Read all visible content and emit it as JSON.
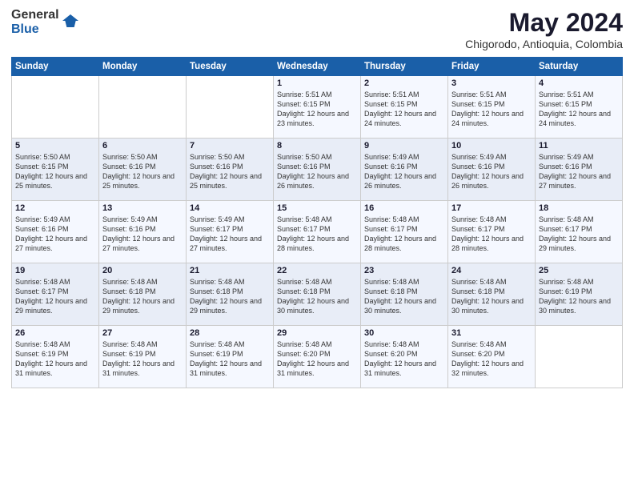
{
  "header": {
    "logo_general": "General",
    "logo_blue": "Blue",
    "title": "May 2024",
    "subtitle": "Chigorodo, Antioquia, Colombia"
  },
  "calendar": {
    "days_of_week": [
      "Sunday",
      "Monday",
      "Tuesday",
      "Wednesday",
      "Thursday",
      "Friday",
      "Saturday"
    ],
    "weeks": [
      [
        {
          "day": "",
          "sunrise": "",
          "sunset": "",
          "daylight": ""
        },
        {
          "day": "",
          "sunrise": "",
          "sunset": "",
          "daylight": ""
        },
        {
          "day": "",
          "sunrise": "",
          "sunset": "",
          "daylight": ""
        },
        {
          "day": "1",
          "sunrise": "Sunrise: 5:51 AM",
          "sunset": "Sunset: 6:15 PM",
          "daylight": "Daylight: 12 hours and 23 minutes."
        },
        {
          "day": "2",
          "sunrise": "Sunrise: 5:51 AM",
          "sunset": "Sunset: 6:15 PM",
          "daylight": "Daylight: 12 hours and 24 minutes."
        },
        {
          "day": "3",
          "sunrise": "Sunrise: 5:51 AM",
          "sunset": "Sunset: 6:15 PM",
          "daylight": "Daylight: 12 hours and 24 minutes."
        },
        {
          "day": "4",
          "sunrise": "Sunrise: 5:51 AM",
          "sunset": "Sunset: 6:15 PM",
          "daylight": "Daylight: 12 hours and 24 minutes."
        }
      ],
      [
        {
          "day": "5",
          "sunrise": "Sunrise: 5:50 AM",
          "sunset": "Sunset: 6:15 PM",
          "daylight": "Daylight: 12 hours and 25 minutes."
        },
        {
          "day": "6",
          "sunrise": "Sunrise: 5:50 AM",
          "sunset": "Sunset: 6:16 PM",
          "daylight": "Daylight: 12 hours and 25 minutes."
        },
        {
          "day": "7",
          "sunrise": "Sunrise: 5:50 AM",
          "sunset": "Sunset: 6:16 PM",
          "daylight": "Daylight: 12 hours and 25 minutes."
        },
        {
          "day": "8",
          "sunrise": "Sunrise: 5:50 AM",
          "sunset": "Sunset: 6:16 PM",
          "daylight": "Daylight: 12 hours and 26 minutes."
        },
        {
          "day": "9",
          "sunrise": "Sunrise: 5:49 AM",
          "sunset": "Sunset: 6:16 PM",
          "daylight": "Daylight: 12 hours and 26 minutes."
        },
        {
          "day": "10",
          "sunrise": "Sunrise: 5:49 AM",
          "sunset": "Sunset: 6:16 PM",
          "daylight": "Daylight: 12 hours and 26 minutes."
        },
        {
          "day": "11",
          "sunrise": "Sunrise: 5:49 AM",
          "sunset": "Sunset: 6:16 PM",
          "daylight": "Daylight: 12 hours and 27 minutes."
        }
      ],
      [
        {
          "day": "12",
          "sunrise": "Sunrise: 5:49 AM",
          "sunset": "Sunset: 6:16 PM",
          "daylight": "Daylight: 12 hours and 27 minutes."
        },
        {
          "day": "13",
          "sunrise": "Sunrise: 5:49 AM",
          "sunset": "Sunset: 6:16 PM",
          "daylight": "Daylight: 12 hours and 27 minutes."
        },
        {
          "day": "14",
          "sunrise": "Sunrise: 5:49 AM",
          "sunset": "Sunset: 6:17 PM",
          "daylight": "Daylight: 12 hours and 27 minutes."
        },
        {
          "day": "15",
          "sunrise": "Sunrise: 5:48 AM",
          "sunset": "Sunset: 6:17 PM",
          "daylight": "Daylight: 12 hours and 28 minutes."
        },
        {
          "day": "16",
          "sunrise": "Sunrise: 5:48 AM",
          "sunset": "Sunset: 6:17 PM",
          "daylight": "Daylight: 12 hours and 28 minutes."
        },
        {
          "day": "17",
          "sunrise": "Sunrise: 5:48 AM",
          "sunset": "Sunset: 6:17 PM",
          "daylight": "Daylight: 12 hours and 28 minutes."
        },
        {
          "day": "18",
          "sunrise": "Sunrise: 5:48 AM",
          "sunset": "Sunset: 6:17 PM",
          "daylight": "Daylight: 12 hours and 29 minutes."
        }
      ],
      [
        {
          "day": "19",
          "sunrise": "Sunrise: 5:48 AM",
          "sunset": "Sunset: 6:17 PM",
          "daylight": "Daylight: 12 hours and 29 minutes."
        },
        {
          "day": "20",
          "sunrise": "Sunrise: 5:48 AM",
          "sunset": "Sunset: 6:18 PM",
          "daylight": "Daylight: 12 hours and 29 minutes."
        },
        {
          "day": "21",
          "sunrise": "Sunrise: 5:48 AM",
          "sunset": "Sunset: 6:18 PM",
          "daylight": "Daylight: 12 hours and 29 minutes."
        },
        {
          "day": "22",
          "sunrise": "Sunrise: 5:48 AM",
          "sunset": "Sunset: 6:18 PM",
          "daylight": "Daylight: 12 hours and 30 minutes."
        },
        {
          "day": "23",
          "sunrise": "Sunrise: 5:48 AM",
          "sunset": "Sunset: 6:18 PM",
          "daylight": "Daylight: 12 hours and 30 minutes."
        },
        {
          "day": "24",
          "sunrise": "Sunrise: 5:48 AM",
          "sunset": "Sunset: 6:18 PM",
          "daylight": "Daylight: 12 hours and 30 minutes."
        },
        {
          "day": "25",
          "sunrise": "Sunrise: 5:48 AM",
          "sunset": "Sunset: 6:19 PM",
          "daylight": "Daylight: 12 hours and 30 minutes."
        }
      ],
      [
        {
          "day": "26",
          "sunrise": "Sunrise: 5:48 AM",
          "sunset": "Sunset: 6:19 PM",
          "daylight": "Daylight: 12 hours and 31 minutes."
        },
        {
          "day": "27",
          "sunrise": "Sunrise: 5:48 AM",
          "sunset": "Sunset: 6:19 PM",
          "daylight": "Daylight: 12 hours and 31 minutes."
        },
        {
          "day": "28",
          "sunrise": "Sunrise: 5:48 AM",
          "sunset": "Sunset: 6:19 PM",
          "daylight": "Daylight: 12 hours and 31 minutes."
        },
        {
          "day": "29",
          "sunrise": "Sunrise: 5:48 AM",
          "sunset": "Sunset: 6:20 PM",
          "daylight": "Daylight: 12 hours and 31 minutes."
        },
        {
          "day": "30",
          "sunrise": "Sunrise: 5:48 AM",
          "sunset": "Sunset: 6:20 PM",
          "daylight": "Daylight: 12 hours and 31 minutes."
        },
        {
          "day": "31",
          "sunrise": "Sunrise: 5:48 AM",
          "sunset": "Sunset: 6:20 PM",
          "daylight": "Daylight: 12 hours and 32 minutes."
        },
        {
          "day": "",
          "sunrise": "",
          "sunset": "",
          "daylight": ""
        }
      ]
    ]
  }
}
